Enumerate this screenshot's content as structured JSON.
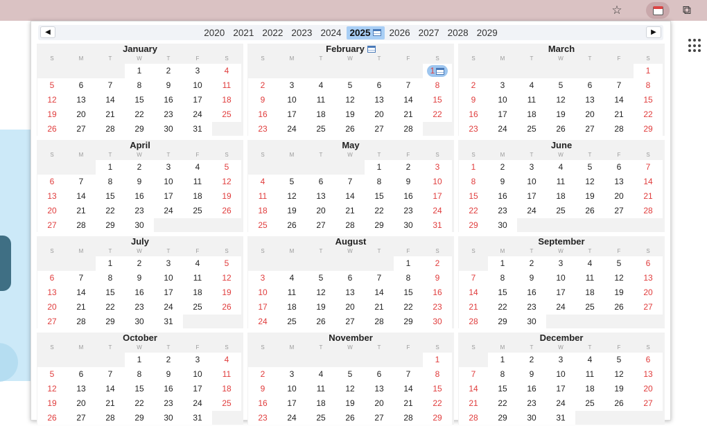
{
  "browser": {
    "star_glyph": "☆",
    "puzzle_glyph": "⧉"
  },
  "calendar": {
    "prev_glyph": "◀",
    "next_glyph": "▶",
    "years": [
      "2020",
      "2021",
      "2022",
      "2023",
      "2024",
      "2025",
      "2026",
      "2027",
      "2028",
      "2029"
    ],
    "current_year": "2025",
    "weekday_labels": [
      "S",
      "M",
      "T",
      "W",
      "T",
      "F",
      "S"
    ],
    "today": {
      "month": 1,
      "day": 1
    },
    "months": [
      {
        "name": "January",
        "offset": 3,
        "days": 31
      },
      {
        "name": "February",
        "offset": 6,
        "days": 28
      },
      {
        "name": "March",
        "offset": 6,
        "days": 31
      },
      {
        "name": "April",
        "offset": 2,
        "days": 30
      },
      {
        "name": "May",
        "offset": 4,
        "days": 31
      },
      {
        "name": "June",
        "offset": 0,
        "days": 30
      },
      {
        "name": "July",
        "offset": 2,
        "days": 31
      },
      {
        "name": "August",
        "offset": 5,
        "days": 31
      },
      {
        "name": "September",
        "offset": 1,
        "days": 30
      },
      {
        "name": "October",
        "offset": 3,
        "days": 31
      },
      {
        "name": "November",
        "offset": 6,
        "days": 30
      },
      {
        "name": "December",
        "offset": 1,
        "days": 31
      }
    ]
  },
  "colors": {
    "weekend": "#e03c3c",
    "current_year_bg": "#a8cef5",
    "today_bg": "#9ec6ef",
    "browser_bar": "#dac2c3"
  }
}
